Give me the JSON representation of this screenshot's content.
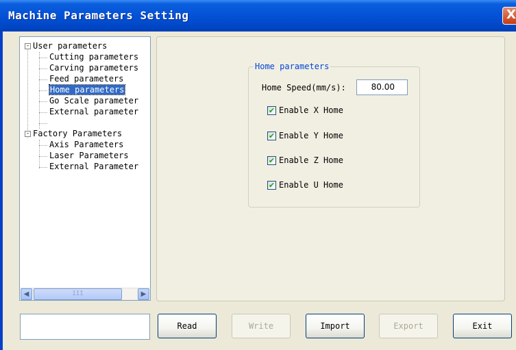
{
  "window": {
    "title": "Machine Parameters Setting",
    "close_glyph": "X"
  },
  "tree": {
    "items": [
      {
        "label": "User parameters",
        "level": 0,
        "expander": "-"
      },
      {
        "label": "Cutting parameters",
        "level": 1
      },
      {
        "label": "Carving parameters",
        "level": 1
      },
      {
        "label": "Feed parameters",
        "level": 1
      },
      {
        "label": "Home parameters",
        "level": 1,
        "selected": true
      },
      {
        "label": "Go Scale parameter",
        "level": 1
      },
      {
        "label": "External parameter",
        "level": 1
      },
      {
        "label": "Factory Parameters",
        "level": 0,
        "expander": "-"
      },
      {
        "label": "Axis Parameters",
        "level": 1
      },
      {
        "label": "Laser Parameters",
        "level": 1
      },
      {
        "label": "External Parameter",
        "level": 1
      }
    ],
    "scroll_left_glyph": "◀",
    "scroll_right_glyph": "▶",
    "scroll_thumb_grip": "III"
  },
  "home_group": {
    "title": "Home parameters",
    "speed_label": "Home Speed(mm/s):",
    "speed_value": "80.00",
    "checkboxes": [
      {
        "label": "Enable X Home",
        "checked": true
      },
      {
        "label": "Enable Y Home",
        "checked": true
      },
      {
        "label": "Enable Z Home",
        "checked": true
      },
      {
        "label": "Enable U Home",
        "checked": true
      }
    ]
  },
  "buttons": {
    "read": "Read",
    "write": "Write",
    "import": "Import",
    "export": "Export",
    "exit": "Exit"
  },
  "checkmark_glyph": "✔",
  "colors": {
    "titlebar": "#0553d8",
    "selection": "#316ac5",
    "group_title": "#0046d5"
  }
}
